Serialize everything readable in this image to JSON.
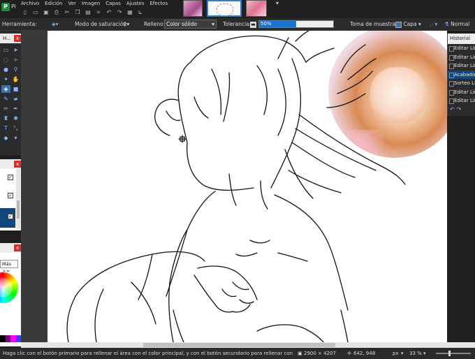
{
  "app": {
    "title": "Pi",
    "logo_letter": "P"
  },
  "menu": [
    "Archivo",
    "Edición",
    "Ver",
    "Imagen",
    "Capas",
    "Ajustes",
    "Efectos"
  ],
  "toolbar": {
    "tool_label": "Herramienta:",
    "mode_label": "Modo de saturación",
    "fill_label": "Relleno:",
    "fill_value": "Color sólido",
    "tolerance_label": "Tolerancia:",
    "tolerance_value": "50%",
    "tolerance_fraction": 0.5,
    "sampling_label": "Toma de muestras:",
    "sampling_value": "Capa",
    "blend_value": "Normal"
  },
  "tools_panel": {
    "title": "H...",
    "close": "x"
  },
  "layers_panel": {
    "close": "x",
    "checkmark": "✓"
  },
  "colors_panel": {
    "close": "x",
    "more_button": "Más >>"
  },
  "history": {
    "title": "Historial",
    "items": [
      "Editar Lín",
      "Editar Lín",
      "Editar Lín",
      "Acabado",
      "Sorteo Lín",
      "Editar Lín",
      "Editar Lín"
    ],
    "selected_index": 3
  },
  "status": {
    "hint": "Haga clic con el botón primario para rellenar el área con el color principal, y con el botón secundario para rellenar con el segundo color.",
    "image_size": "2900 × 4207",
    "cursor_pos": "642, 948",
    "unit": "px",
    "zoom": "33 %"
  },
  "colors": {
    "accent": "#1874d0",
    "selection": "#11477a",
    "close_red": "#d32f2f"
  }
}
